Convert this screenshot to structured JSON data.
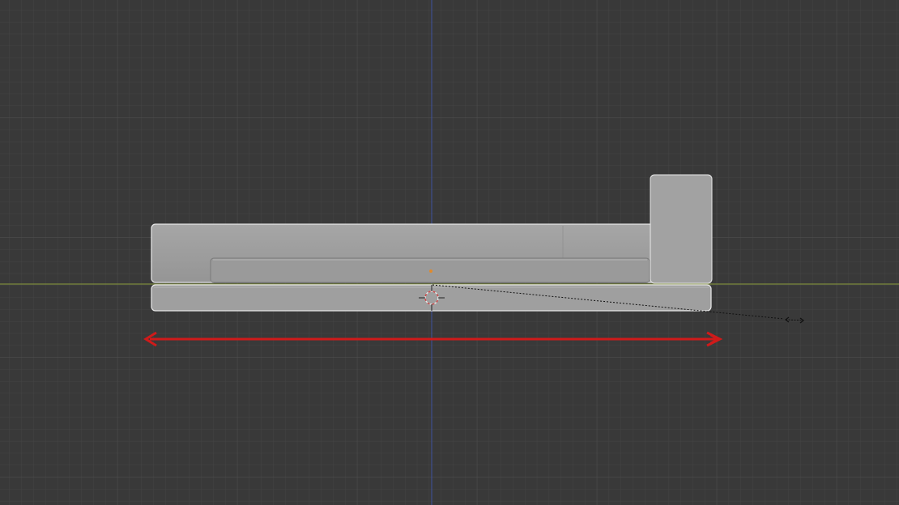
{
  "viewport": {
    "view": "front-orthographic",
    "background_color": "#393939",
    "grid_minor_color": "#444444",
    "grid_major_color": "#4e4e4e",
    "axis_x_color": "#7d8a3d",
    "axis_z_color": "#3f4f8f",
    "grid_visible": true
  },
  "scene": {
    "mesh_color": "#9e9e9e",
    "selection_outline_color": "#e8e8e8",
    "origin_point_color": "#e08a2c",
    "cursor_icon": "3d-cursor-icon",
    "transform_cursor_icon": "scale-arrows-icon"
  },
  "annotation": {
    "type": "width-measure-arrow",
    "color": "#d01a1a"
  }
}
